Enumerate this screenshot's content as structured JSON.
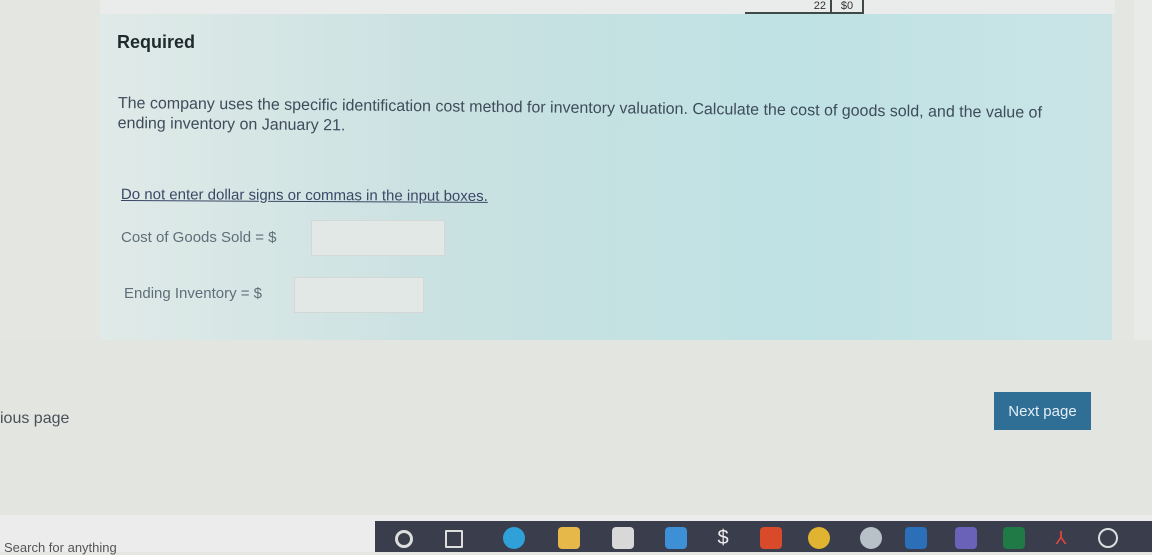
{
  "top_table": {
    "cell_1": "22",
    "cell_2": "$0"
  },
  "heading": "Required",
  "question_text": "The company uses the specific identification cost method for inventory valuation. Calculate the cost of goods sold, and the value of ending inventory on January 21.",
  "note": "Do not enter dollar signs or commas in the input boxes.",
  "fields": {
    "cogs_label": "Cost of Goods Sold = $",
    "cogs_value": "",
    "ending_label": "Ending Inventory = $",
    "ending_value": ""
  },
  "nav": {
    "previous": "ious page",
    "next": "Next page"
  },
  "taskbar": {
    "search_hint": "Search for anything",
    "icons": [
      "cortana-icon",
      "task-view-icon",
      "edge-icon",
      "file-explorer-icon",
      "store-icon",
      "mail-icon",
      "app-icon",
      "office-icon",
      "chrome-icon",
      "app-icon-2",
      "outlook-icon",
      "teams-icon",
      "excel-icon",
      "acrobat-icon",
      "help-icon"
    ]
  }
}
